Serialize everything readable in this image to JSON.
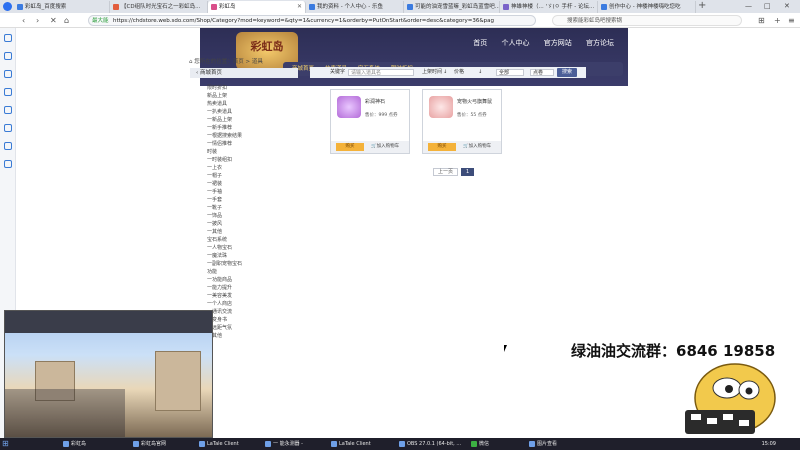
{
  "browser": {
    "tabs": [
      {
        "label": "彩虹岛_百度搜索",
        "color": "#3b7be0"
      },
      {
        "label": "【CD组队时光宝石之一彩虹岛...",
        "color": "#e25d3d"
      },
      {
        "label": "彩虹岛",
        "color": "#d94f8a"
      },
      {
        "label": "我的资料 - 个人中心 - 乐鱼",
        "color": "#3b7be0"
      },
      {
        "label": "可能的油宠雪蓝嘛_彩虹岛蓝雪吧...",
        "color": "#3b7be0"
      },
      {
        "label": "神雄神楼（... 'ゞ(ㅇ 手杆 - 论坛...",
        "color": "#7a63c9"
      },
      {
        "label": "创作中心 - 神楼神楼嗨吃您吃",
        "color": "#3b7be0"
      }
    ],
    "active_tab": 2,
    "url_secure_label": "最大能",
    "url": "https://chdstore.web.sdo.com/Shop/Category?mod=keyword=&qty=1&currency=1&orderby=PutOnStart&order=desc&category=36&pag",
    "search_hint": "搜索能彩虹岛吧搜索锅",
    "controls": [
      "—",
      "□",
      "✕"
    ]
  },
  "site": {
    "logo": "彩虹岛",
    "topnav": [
      "首页",
      "个人中心",
      "官方网站",
      "官方论坛"
    ],
    "subnav": [
      "商城首页",
      "热卖道具",
      "宝石系统",
      "限时折扣"
    ],
    "breadcrumb": "您所在的位置：首页 > 道具",
    "left_header": "商城首页",
    "left_items": [
      "限时折扣",
      "新品上架",
      "热卖道具",
      "一扒卖道具",
      "一新品上架",
      "一新手推荐",
      "一根据搜索结果",
      "一情侣推荐",
      "时装",
      "一时装组扣",
      "一上衣",
      "一帽子",
      "一裙装",
      "一手袖",
      "一手套",
      "一靴子",
      "一饰品",
      "一披风",
      "一其他",
      "宝石系统",
      "一人物宝石",
      "一魔法珠",
      "一副职宠物宝石",
      "功能",
      "一功能商品",
      "一能力提升",
      "一美容美发",
      "一个人商店",
      "一通讯交流",
      "一变身书",
      "一远距气氛",
      "一其他"
    ],
    "filter": {
      "keyword_label": "关键字",
      "keyword_placeholder": "请输入道具名",
      "date_label": "上架时间",
      "date_value": "↓",
      "price_label": "价格",
      "price_value": "↓",
      "category_label": "分类",
      "category_value": "全部",
      "point_label": "点卷",
      "search_button": "搜索"
    },
    "products": [
      {
        "name": "彩润神石",
        "price": "售价：999 点券",
        "buy": "购买",
        "cart": "加入购物车",
        "color": "#b36bd8"
      },
      {
        "name": "宠物火弓旗舞鼠",
        "price": "售价：55 点券",
        "buy": "购买",
        "cart": "加入购物车",
        "color": "#e8a2a2"
      }
    ],
    "pager": {
      "prev": "上一页",
      "current": "1"
    }
  },
  "overlay": {
    "stream_text": "绿油油交流群：6846 19858"
  },
  "taskbar": {
    "items": [
      "彩虹岛",
      "彩虹岛官网",
      "LaTale Client",
      "一 能永测器 -",
      "LaTale Client",
      "OBS 27.0.1 (64-bit, ...",
      "微信",
      "图片查看"
    ],
    "clock": "15:09"
  }
}
